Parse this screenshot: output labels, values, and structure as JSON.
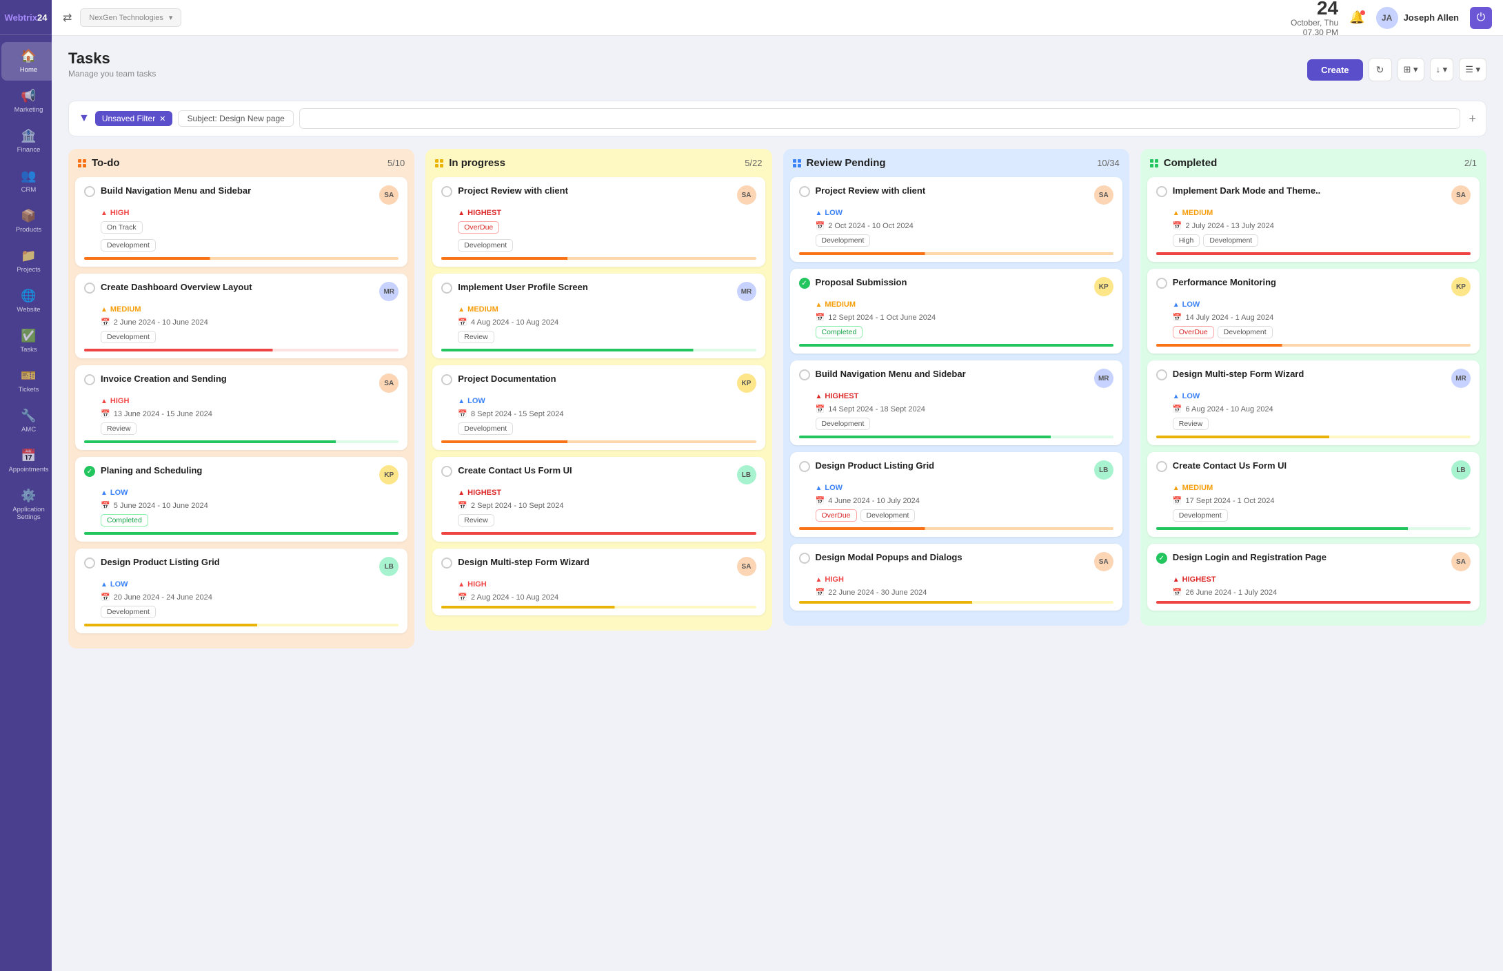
{
  "app": {
    "name": "Webtrix24",
    "name_colored": "24"
  },
  "topbar": {
    "org_name": "NexGen Technologies",
    "date_day": "24",
    "date_month_weekday": "October, Thu",
    "date_time": "07.30 PM",
    "user_name": "Joseph Allen",
    "switch_icon": "⇄",
    "bell_icon": "🔔",
    "power_icon": "⏻"
  },
  "page": {
    "title": "Tasks",
    "subtitle": "Manage you team tasks"
  },
  "toolbar": {
    "create_label": "Create",
    "refresh_icon": "↻",
    "view_grid_icon": "⊞",
    "download_icon": "↓",
    "list_icon": "☰"
  },
  "filter": {
    "icon": "▼",
    "unsaved_label": "Unsaved Filter",
    "subject_label": "Subject: Design New page",
    "add_icon": "+"
  },
  "columns": [
    {
      "id": "todo",
      "title": "To-do",
      "count": "5/10",
      "color_class": "col-todo",
      "dot_class": "col-todo"
    },
    {
      "id": "inprogress",
      "title": "In progress",
      "count": "5/22",
      "color_class": "col-inprogress",
      "dot_class": "col-inprogress"
    },
    {
      "id": "review",
      "title": "Review Pending",
      "count": "10/34",
      "color_class": "col-review",
      "dot_class": "col-review"
    },
    {
      "id": "completed",
      "title": "Completed",
      "count": "2/1",
      "color_class": "col-completed",
      "dot_class": "col-completed"
    }
  ],
  "todo_cards": [
    {
      "title": "Build Navigation Menu and Sidebar",
      "priority": "HIGH",
      "priority_class": "priority-high",
      "date": "On Track",
      "date_is_tag": true,
      "tags": [
        "Development"
      ],
      "progress_class": "progress-orange",
      "avatar": "av1",
      "checked": false
    },
    {
      "title": "Create Dashboard Overview Layout",
      "priority": "MEDIUM",
      "priority_class": "priority-medium",
      "date": "2 June 2024 - 10 June 2024",
      "tags": [
        "Development"
      ],
      "progress_class": "progress-red",
      "avatar": "av2",
      "checked": false
    },
    {
      "title": "Invoice Creation and Sending",
      "priority": "HIGH",
      "priority_class": "priority-high",
      "date": "13 June 2024 - 15 June 2024",
      "tags": [
        "Review"
      ],
      "progress_class": "progress-green",
      "avatar": "av1",
      "checked": false
    },
    {
      "title": "Planing and Scheduling",
      "priority": "LOW",
      "priority_class": "priority-low",
      "date": "5 June 2024 - 10 June 2024",
      "tags": [
        "Completed"
      ],
      "tag_classes": [
        "completed"
      ],
      "progress_class": "progress-full-green",
      "avatar": "av3",
      "checked": true
    },
    {
      "title": "Design Product Listing Grid",
      "priority": "LOW",
      "priority_class": "priority-low",
      "date": "20 June 2024 - 24 June 2024",
      "tags": [
        "Development"
      ],
      "progress_class": "progress-yellow",
      "avatar": "av4",
      "checked": false
    }
  ],
  "inprogress_cards": [
    {
      "title": "Project Review with client",
      "priority": "HIGHEST",
      "priority_class": "priority-highest",
      "date": "OverDue",
      "date_is_overdue": true,
      "tags": [
        "Development"
      ],
      "tag_classes": [
        "development"
      ],
      "progress_class": "progress-orange",
      "avatar": "av1",
      "checked": false
    },
    {
      "title": "Implement User Profile Screen",
      "priority": "MEDIUM",
      "priority_class": "priority-medium",
      "date": "4 Aug 2024 - 10 Aug 2024",
      "tags": [
        "Review"
      ],
      "progress_class": "progress-green",
      "avatar": "av2",
      "checked": false
    },
    {
      "title": "Project Documentation",
      "priority": "LOW",
      "priority_class": "priority-low",
      "date": "8 Sept 2024 - 15 Sept 2024",
      "tags": [
        "Development"
      ],
      "progress_class": "progress-orange",
      "avatar": "av3",
      "checked": false
    },
    {
      "title": "Create Contact Us Form UI",
      "priority": "HIGHEST",
      "priority_class": "priority-highest",
      "date": "2 Sept 2024 - 10 Sept 2024",
      "tags": [
        "Review"
      ],
      "progress_class": "progress-full-red",
      "avatar": "av4",
      "checked": false
    },
    {
      "title": "Design Multi-step Form Wizard",
      "priority": "HIGH",
      "priority_class": "priority-high",
      "date": "2 Aug 2024 - 10 Aug 2024",
      "tags": [],
      "progress_class": "progress-yellow",
      "avatar": "av1",
      "checked": false
    }
  ],
  "review_cards": [
    {
      "title": "Project Review with client",
      "priority": "LOW",
      "priority_class": "priority-low",
      "date": "2 Oct 2024 - 10 Oct 2024",
      "tags": [
        "Development"
      ],
      "progress_class": "progress-orange",
      "avatar": "av1",
      "checked": false
    },
    {
      "title": "Proposal Submission",
      "priority": "MEDIUM",
      "priority_class": "priority-medium",
      "date": "12 Sept 2024 - 1 Oct June 2024",
      "tags": [
        "Completed"
      ],
      "tag_classes": [
        "completed"
      ],
      "progress_class": "progress-full-green",
      "avatar": "av3",
      "checked": true
    },
    {
      "title": "Build Navigation Menu and Sidebar",
      "priority": "HIGHEST",
      "priority_class": "priority-highest",
      "date": "14 Sept 2024 - 18 Sept 2024",
      "tags": [
        "Development"
      ],
      "progress_class": "progress-green",
      "avatar": "av2",
      "checked": false
    },
    {
      "title": "Design Product Listing Grid",
      "priority": "LOW",
      "priority_class": "priority-low",
      "date": "4 June 2024 - 10 July 2024",
      "tags": [
        "OverDue",
        "Development"
      ],
      "tag_classes": [
        "overdue",
        "development"
      ],
      "progress_class": "progress-orange",
      "avatar": "av4",
      "checked": false
    },
    {
      "title": "Design Modal Popups and Dialogs",
      "priority": "HIGH",
      "priority_class": "priority-high",
      "date": "22 June 2024 - 30 June 2024",
      "tags": [],
      "progress_class": "progress-yellow",
      "avatar": "av1",
      "checked": false
    }
  ],
  "completed_cards": [
    {
      "title": "Implement Dark Mode and Theme..",
      "priority": "MEDIUM",
      "priority_class": "priority-medium",
      "date": "2 July 2024 - 13 July 2024",
      "tags": [
        "High",
        "Development"
      ],
      "tag_classes": [
        "",
        "development"
      ],
      "progress_class": "progress-full-red",
      "avatar": "av1",
      "checked": false
    },
    {
      "title": "Performance Monitoring",
      "priority": "LOW",
      "priority_class": "priority-low",
      "date": "14 July 2024 - 1 Aug 2024",
      "tags": [
        "OverDue",
        "Development"
      ],
      "tag_classes": [
        "overdue",
        "development"
      ],
      "progress_class": "progress-orange",
      "avatar": "av3",
      "checked": false
    },
    {
      "title": "Design Multi-step Form Wizard",
      "priority": "LOW",
      "priority_class": "priority-low",
      "date": "6 Aug 2024 - 10 Aug 2024",
      "tags": [
        "Review"
      ],
      "progress_class": "progress-yellow",
      "avatar": "av2",
      "checked": false
    },
    {
      "title": "Create Contact Us Form UI",
      "priority": "MEDIUM",
      "priority_class": "priority-medium",
      "date": "17 Sept 2024 - 1 Oct 2024",
      "tags": [
        "Development"
      ],
      "progress_class": "progress-green",
      "avatar": "av4",
      "checked": false
    },
    {
      "title": "Design Login and Registration Page",
      "priority": "HIGHEST",
      "priority_class": "priority-highest",
      "date": "26 June 2024 - 1 July 2024",
      "tags": [],
      "progress_class": "progress-full-red",
      "avatar": "av1",
      "checked": true
    }
  ],
  "sidebar_items": [
    {
      "icon": "🏠",
      "label": "Home",
      "active": true
    },
    {
      "icon": "📢",
      "label": "Marketing",
      "active": false
    },
    {
      "icon": "🏦",
      "label": "Finance",
      "active": false
    },
    {
      "icon": "👥",
      "label": "CRM",
      "active": false
    },
    {
      "icon": "📦",
      "label": "Products",
      "active": false
    },
    {
      "icon": "📁",
      "label": "Projects",
      "active": false
    },
    {
      "icon": "🌐",
      "label": "Website",
      "active": false
    },
    {
      "icon": "✅",
      "label": "Tasks",
      "active": false
    },
    {
      "icon": "🎫",
      "label": "Tickets",
      "active": false
    },
    {
      "icon": "🔧",
      "label": "AMC",
      "active": false
    },
    {
      "icon": "📅",
      "label": "Appointments",
      "active": false
    },
    {
      "icon": "⚙️",
      "label": "Application Settings",
      "active": false
    }
  ]
}
